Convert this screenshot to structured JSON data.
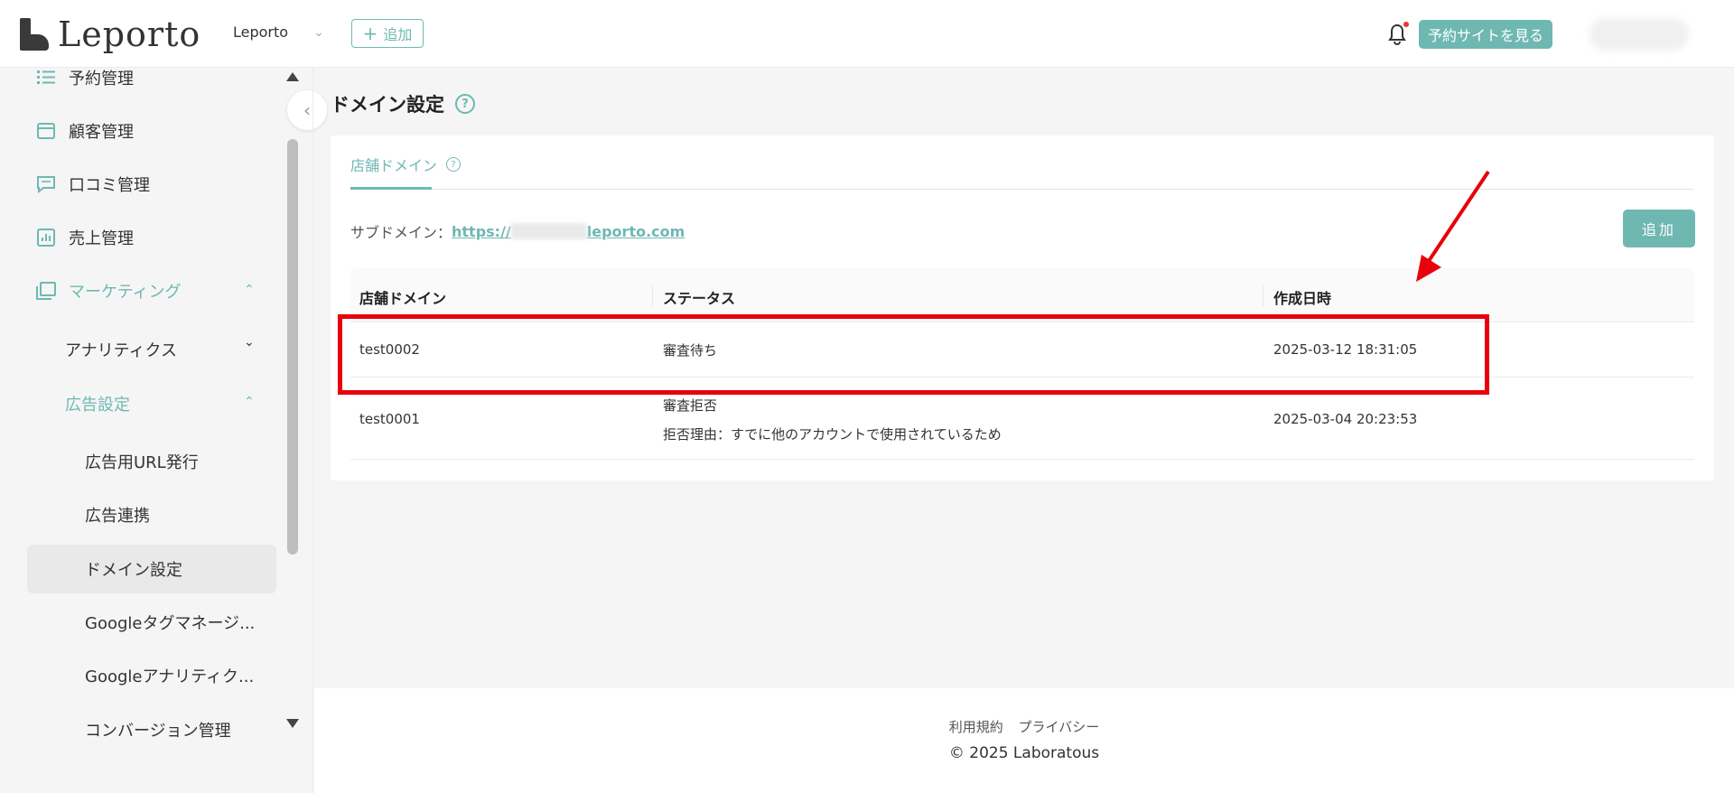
{
  "header": {
    "logo_text": "Leporto",
    "store_name": "Leporto",
    "add_label": "追加",
    "view_site_label": "予約サイトを見る"
  },
  "sidebar": {
    "items": [
      {
        "label": "予約管理",
        "icon": "list-icon"
      },
      {
        "label": "顧客管理",
        "icon": "store-icon"
      },
      {
        "label": "口コミ管理",
        "icon": "comment-icon"
      },
      {
        "label": "売上管理",
        "icon": "chart-icon"
      },
      {
        "label": "マーケティング",
        "icon": "marketing-icon"
      }
    ],
    "sub_items": {
      "analytics": "アナリティクス",
      "ad_settings": "広告設定",
      "ad_url": "広告用URL発行",
      "ad_link": "広告連携",
      "domain": "ドメイン設定",
      "gtm": "Googleタグマネージ...",
      "ga": "Googleアナリティク...",
      "conversion": "コンバージョン管理"
    }
  },
  "main": {
    "title": "ドメイン設定",
    "tab_label": "店舗ドメイン",
    "subdomain_label": "サブドメイン：",
    "subdomain_link_prefix": "https://",
    "subdomain_link_suffix": "leporto.com",
    "add_domain_label": "追加",
    "table": {
      "headers": [
        "店舗ドメイン",
        "ステータス",
        "作成日時"
      ],
      "rows": [
        {
          "domain": "test0002",
          "status": "審査待ち",
          "status_note": "",
          "created": "2025-03-12 18:31:05"
        },
        {
          "domain": "test0001",
          "status": "審査拒否",
          "status_note": "拒否理由：すでに他のアカウントで使用されているため",
          "created": "2025-03-04 20:23:53"
        }
      ]
    }
  },
  "footer": {
    "terms": "利用規約",
    "privacy": "プライバシー",
    "copyright": "© 2025 Laboratous"
  },
  "colors": {
    "accent": "#6fb8b2",
    "annotation": "#e8000b"
  }
}
